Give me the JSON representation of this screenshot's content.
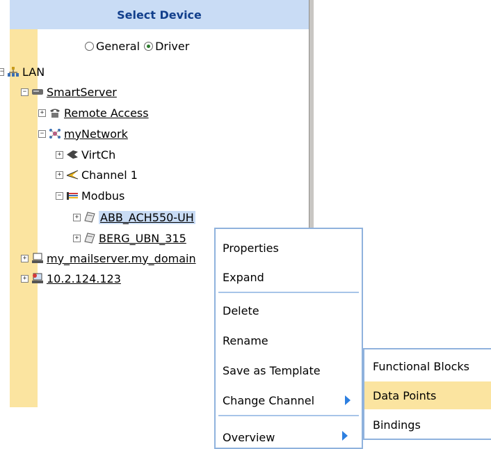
{
  "panel": {
    "title": "Select Device"
  },
  "view_mode": {
    "general_label": "General",
    "driver_label": "Driver",
    "selected": "Driver"
  },
  "tree": {
    "lan": "LAN",
    "smartserver": "SmartServer",
    "remote_access": "Remote Access",
    "mynetwork": "myNetwork",
    "virtch": "VirtCh",
    "channel1": "Channel 1",
    "modbus": "Modbus",
    "abb": "ABB_ACH550-UH",
    "berg": "BERG_UBN_315",
    "mailserver": "my_mailserver.my_domain",
    "ip": "10.2.124.123"
  },
  "context_menu": {
    "properties": "Properties",
    "expand": "Expand",
    "delete": "Delete",
    "rename": "Rename",
    "save_template": "Save as Template",
    "change_channel": "Change Channel",
    "overview": "Overview"
  },
  "submenu": {
    "functional_blocks": "Functional Blocks",
    "data_points": "Data Points",
    "bindings": "Bindings"
  },
  "colors": {
    "header_bg": "#c9dcf5",
    "header_text": "#123f8c",
    "gutter": "#fbe4a0",
    "menu_border": "#8fb2dd",
    "arrow": "#2d7fe0",
    "highlight": "#fbe4a0"
  }
}
